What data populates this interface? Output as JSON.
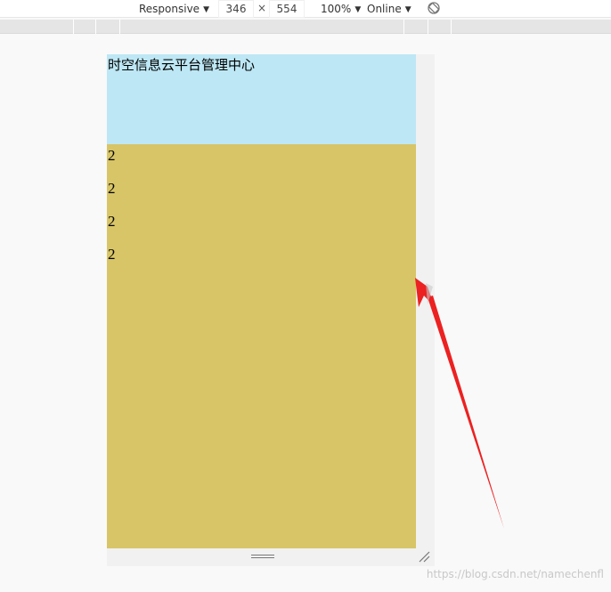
{
  "toolbar": {
    "device_mode": "Responsive",
    "width": "346",
    "separator": "×",
    "height": "554",
    "zoom": "100%",
    "throttling": "Online"
  },
  "page": {
    "title": "时空信息云平台管理中心",
    "items": [
      "2",
      "2",
      "2",
      "2"
    ]
  },
  "colors": {
    "header_bg": "#bde7f4",
    "content_bg": "#d8c567",
    "arrow": "#ec2121"
  },
  "watermark": "https://blog.csdn.net/namechenfl"
}
